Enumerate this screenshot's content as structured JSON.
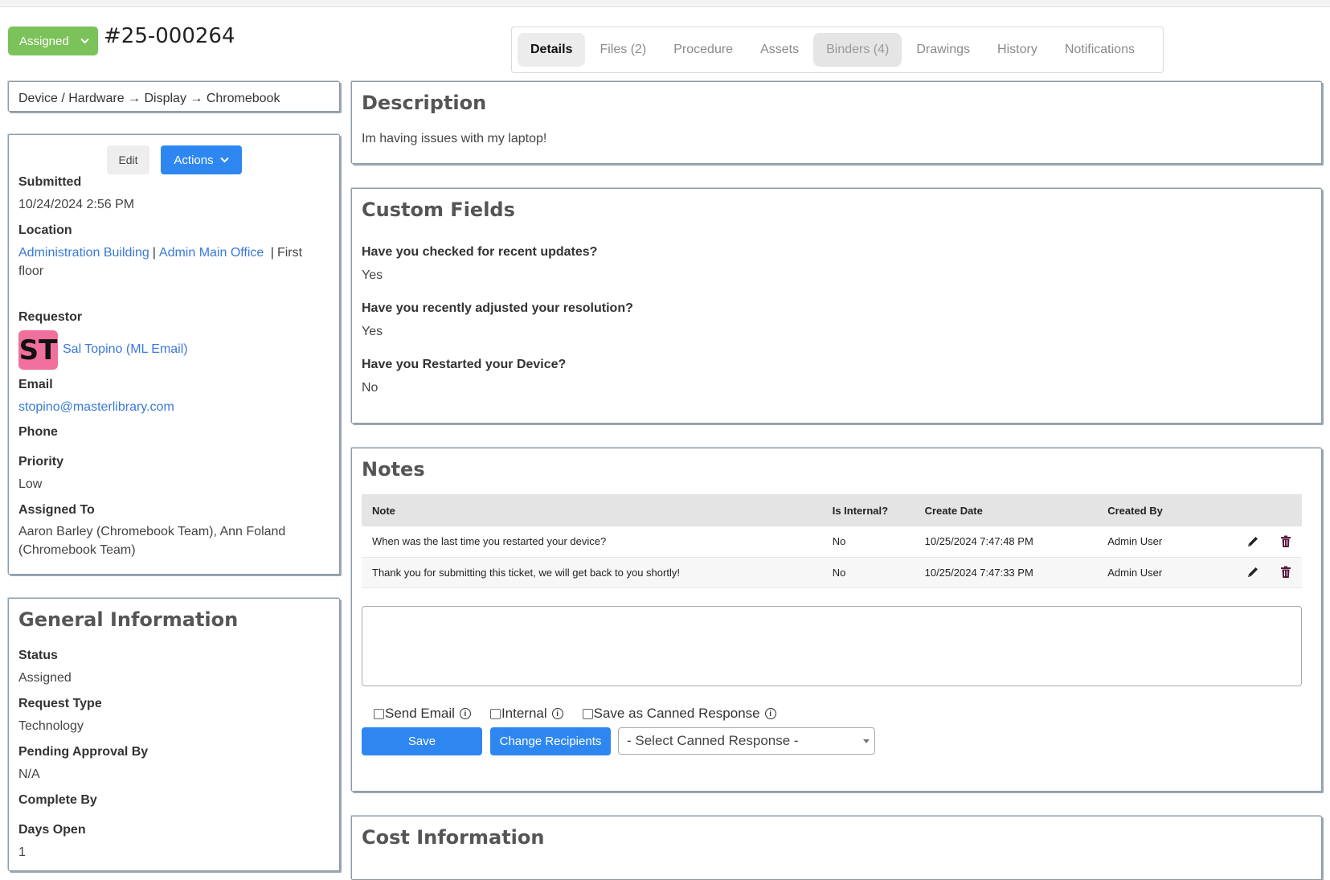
{
  "header": {
    "status_label": "Assigned",
    "ticket_number": "#25-000264"
  },
  "tabs": [
    {
      "label": "Details",
      "active": true
    },
    {
      "label": "Files (2)"
    },
    {
      "label": "Procedure"
    },
    {
      "label": "Assets"
    },
    {
      "label": "Binders (4)"
    },
    {
      "label": "Drawings"
    },
    {
      "label": "History"
    },
    {
      "label": "Notifications"
    }
  ],
  "breadcrumb": "Device / Hardware → Display → Chromebook",
  "info": {
    "edit_label": "Edit",
    "actions_label": "Actions",
    "submitted_label": "Submitted",
    "submitted_value": "10/24/2024 2:56 PM",
    "location_label": "Location",
    "location_building": "Administration Building",
    "location_room": "Admin Main Office",
    "location_floor": "First floor",
    "requestor_label": "Requestor",
    "requestor_initials": "ST",
    "requestor_name": "Sal Topino (ML Email)",
    "email_label": "Email",
    "email_value": "stopino@masterlibrary.com",
    "phone_label": "Phone",
    "priority_label": "Priority",
    "priority_value": "Low",
    "assigned_label": "Assigned To",
    "assigned_value": "Aaron Barley (Chromebook Team), Ann Foland (Chromebook Team)"
  },
  "general": {
    "title": "General Information",
    "status_label": "Status",
    "status_value": "Assigned",
    "request_type_label": "Request Type",
    "request_type_value": "Technology",
    "pending_label": "Pending Approval By",
    "pending_value": "N/A",
    "complete_label": "Complete By",
    "days_label": "Days Open",
    "days_value": "1"
  },
  "description": {
    "title": "Description",
    "text": "Im having issues with my laptop!"
  },
  "custom_fields": {
    "title": "Custom Fields",
    "items": [
      {
        "question": "Have you checked for recent updates?",
        "answer": "Yes"
      },
      {
        "question": "Have you recently adjusted your resolution?",
        "answer": "Yes"
      },
      {
        "question": "Have you Restarted your Device?",
        "answer": "No"
      }
    ]
  },
  "notes": {
    "title": "Notes",
    "columns": [
      "Note",
      "Is Internal?",
      "Create Date",
      "Created By"
    ],
    "rows": [
      {
        "note": "When was the last time you restarted your device?",
        "internal": "No",
        "date": "10/25/2024 7:47:48 PM",
        "by": "Admin User"
      },
      {
        "note": "Thank you for submitting this ticket, we will get back to you shortly!",
        "internal": "No",
        "date": "10/25/2024 7:47:33 PM",
        "by": "Admin User"
      }
    ],
    "send_email_label": "Send Email",
    "internal_label": "Internal",
    "canned_label": "Save as Canned Response",
    "save_label": "Save",
    "change_recipients_label": "Change Recipients",
    "canned_select": "- Select Canned Response -"
  },
  "cost": {
    "title": "Cost Information"
  },
  "colors": {
    "status_green": "#7cc25a",
    "primary_blue": "#2e87f0",
    "link_blue": "#3a79d8",
    "avatar_pink": "#f06f9c"
  }
}
